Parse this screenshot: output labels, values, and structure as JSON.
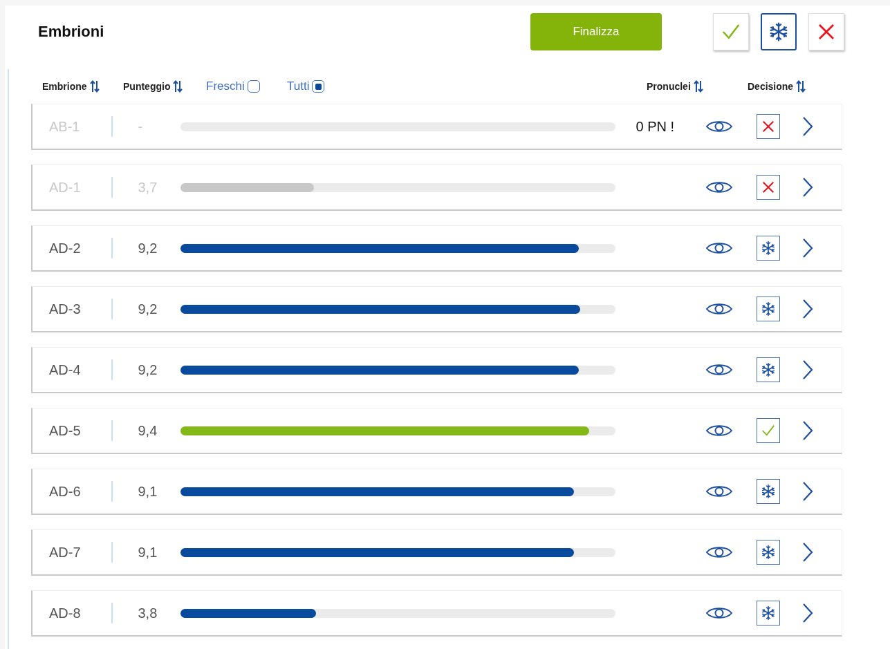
{
  "title": "Embrioni",
  "finalize_button": "Finalizza",
  "decision_buttons": [
    {
      "kind": "accept",
      "selected": false
    },
    {
      "kind": "freeze",
      "selected": true
    },
    {
      "kind": "reject",
      "selected": false
    }
  ],
  "columns": [
    {
      "kind": "sort",
      "label": "Embrione"
    },
    {
      "kind": "sort",
      "label": "Punteggio"
    },
    {
      "kind": "filter",
      "label": "Freschi",
      "checked": false
    },
    {
      "kind": "filter",
      "label": "Tutti",
      "checked": true
    },
    {
      "kind": "sort",
      "label": "Pronuclei"
    },
    {
      "kind": "sort",
      "label": "Decisione"
    }
  ],
  "embryos": [
    {
      "id": "AB-1",
      "score": "-",
      "pronuclei": "0 PN !",
      "kind": "reject",
      "disabled": true
    },
    {
      "id": "AD-1",
      "score": "3,7",
      "level": 0.307,
      "kind": "reject",
      "disabled": true
    },
    {
      "id": "AD-2",
      "score": "9,2",
      "level": 0.916,
      "kind": "freeze",
      "disabled": false
    },
    {
      "id": "AD-3",
      "score": "9,2",
      "level": 0.92,
      "kind": "freeze",
      "disabled": false
    },
    {
      "id": "AD-4",
      "score": "9,2",
      "level": 0.916,
      "kind": "freeze",
      "disabled": false
    },
    {
      "id": "AD-5",
      "score": "9,4",
      "level": 0.94,
      "kind": "accept",
      "disabled": false
    },
    {
      "id": "AD-6",
      "score": "9,1",
      "level": 0.906,
      "kind": "freeze",
      "disabled": false
    },
    {
      "id": "AD-7",
      "score": "9,1",
      "level": 0.905,
      "kind": "freeze",
      "disabled": false
    },
    {
      "id": "AD-8",
      "score": "3,8",
      "level": 0.313,
      "kind": "freeze",
      "disabled": false
    }
  ]
}
